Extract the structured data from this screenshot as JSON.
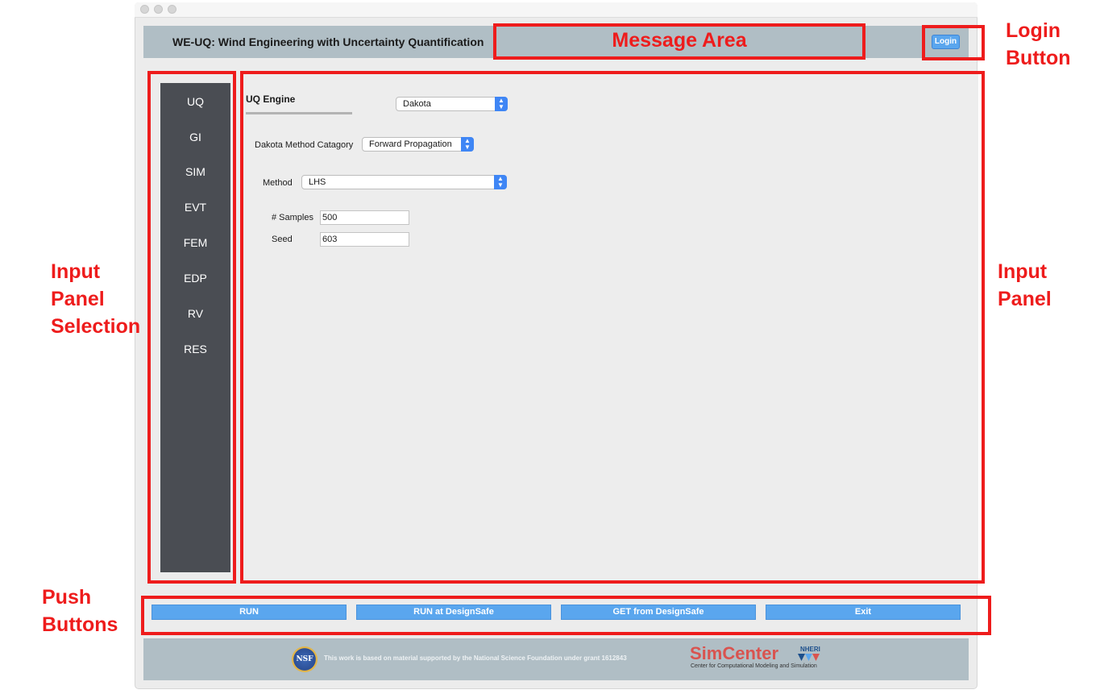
{
  "app": {
    "title": "WE-UQ: Wind Engineering with Uncertainty Quantification",
    "login_label": "Login"
  },
  "sidebar": {
    "items": [
      {
        "label": "UQ"
      },
      {
        "label": "GI"
      },
      {
        "label": "SIM"
      },
      {
        "label": "EVT"
      },
      {
        "label": "FEM"
      },
      {
        "label": "EDP"
      },
      {
        "label": "RV"
      },
      {
        "label": "RES"
      }
    ]
  },
  "uq_panel": {
    "section_label": "UQ Engine",
    "engine_value": "Dakota",
    "method_category_label": "Dakota Method Catagory",
    "method_category_value": "Forward Propagation",
    "method_label": "Method",
    "method_value": "LHS",
    "samples_label": "# Samples",
    "samples_value": "500",
    "seed_label": "Seed",
    "seed_value": "603"
  },
  "buttons": {
    "run": "RUN",
    "run_designsafe": "RUN at DesignSafe",
    "get_designsafe": "GET from DesignSafe",
    "exit": "Exit"
  },
  "footer": {
    "nsf_logo": "NSF",
    "grant_text": "This work is based on material supported by the National Science Foundation under grant 1612843",
    "simcenter": "SimCenter",
    "nheri": "NHERI",
    "simcenter_sub": "Center for Computational Modeling and Simulation"
  },
  "annotations": {
    "message_area": "Message Area",
    "login_line1": "Login",
    "login_line2": "Button",
    "input_sel_line1": "Input",
    "input_sel_line2": "Panel",
    "input_sel_line3": "Selection",
    "input_panel_line1": "Input",
    "input_panel_line2": "Panel",
    "push_line1": "Push",
    "push_line2": "Buttons"
  },
  "colors": {
    "annotation": "#ee1c1c",
    "header": "#b0bec5",
    "sidebar": "#4a4d53",
    "button": "#5aa6ee"
  }
}
